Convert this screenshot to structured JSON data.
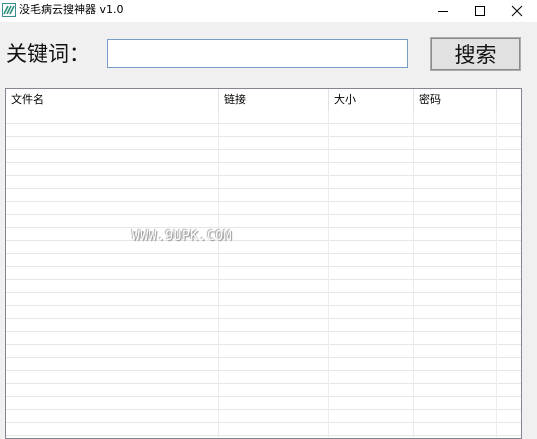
{
  "window": {
    "title": "没毛病云搜神器 v1.0",
    "icon": "app-logo-icon",
    "controls": [
      "minimize-icon",
      "maximize-icon",
      "close-icon"
    ]
  },
  "search": {
    "label": "关键词：",
    "input_value": "",
    "button_label": "搜索"
  },
  "table": {
    "columns": [
      {
        "label": "文件名"
      },
      {
        "label": "链接"
      },
      {
        "label": "大小"
      },
      {
        "label": "密码"
      }
    ],
    "rows": []
  },
  "watermark": "WWW.9UPK.COM",
  "colors": {
    "background": "#f0f0f0",
    "input_border": "#7a9cc6",
    "button_face": "#e1e1e1",
    "list_border": "#828790",
    "grid_line": "#e6e6e6"
  }
}
